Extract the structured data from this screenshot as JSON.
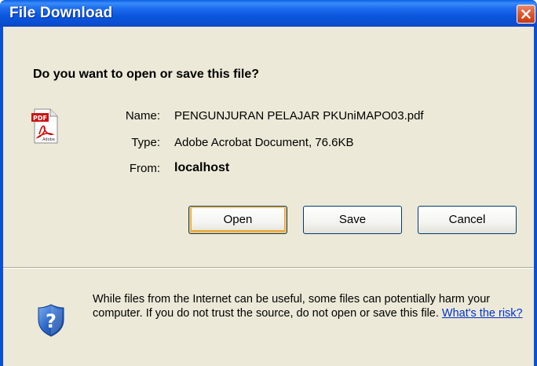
{
  "window": {
    "title": "File Download"
  },
  "dialog": {
    "question": "Do you want to open or save this file?",
    "file": {
      "name_label": "Name:",
      "name_value": "PENGUNJURAN PELAJAR PKUniMAPO03.pdf",
      "type_label": "Type:",
      "type_value": "Adobe Acrobat Document, 76.6KB",
      "from_label": "From:",
      "from_value": "localhost"
    },
    "icon": "pdf-file-icon",
    "icon_text_top": "PDF",
    "icon_text_bottom": "Adobe"
  },
  "buttons": {
    "open": "Open",
    "save": "Save",
    "cancel": "Cancel"
  },
  "warning": {
    "icon": "shield-question-icon",
    "text": "While files from the Internet can be useful, some files can potentially harm your computer. If you do not trust the source, do not open or save this file.",
    "link": "What's the risk?"
  },
  "colors": {
    "titlebar": "#0a56dd",
    "client": "#ece9d8",
    "close_button": "#de5a32",
    "link": "#0033cc"
  }
}
